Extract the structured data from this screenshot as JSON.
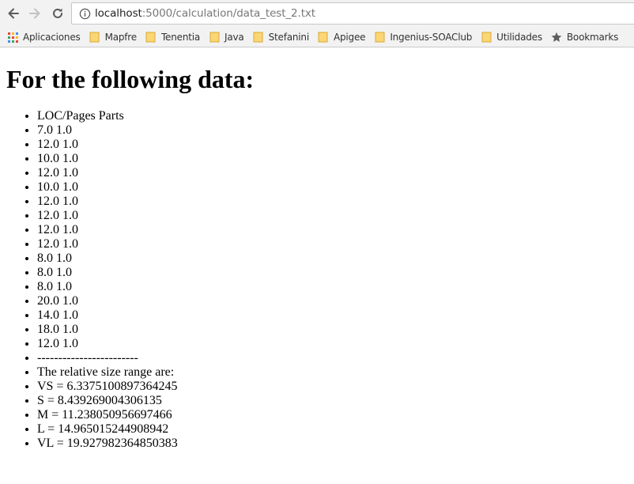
{
  "browser": {
    "url_host": "localhost",
    "url_path": ":5000/calculation/data_test_2.txt",
    "bookmarks": [
      {
        "label": "Aplicaciones",
        "icon": "apps-grid-icon"
      },
      {
        "label": "Mapfre",
        "icon": "folder-icon"
      },
      {
        "label": "Tenentia",
        "icon": "folder-icon"
      },
      {
        "label": "Java",
        "icon": "folder-icon"
      },
      {
        "label": "Stefanini",
        "icon": "folder-icon"
      },
      {
        "label": "Apigee",
        "icon": "folder-icon"
      },
      {
        "label": "Ingenius-SOAClub",
        "icon": "folder-icon"
      },
      {
        "label": "Utilidades",
        "icon": "folder-icon"
      },
      {
        "label": "Bookmarks",
        "icon": "star-icon"
      }
    ]
  },
  "page": {
    "heading": "For the following data:",
    "items": [
      "LOC/Pages Parts",
      "7.0 1.0",
      "12.0 1.0",
      "10.0 1.0",
      "12.0 1.0",
      "10.0 1.0",
      "12.0 1.0",
      "12.0 1.0",
      "12.0 1.0",
      "12.0 1.0",
      "8.0 1.0",
      "8.0 1.0",
      "8.0 1.0",
      "20.0 1.0",
      "14.0 1.0",
      "18.0 1.0",
      "12.0 1.0",
      "------------------------",
      "The relative size range are:",
      "VS = 6.3375100897364245",
      "S = 8.439269004306135",
      "M = 11.238050956697466",
      "L = 14.965015244908942",
      "VL = 19.927982364850383"
    ]
  }
}
